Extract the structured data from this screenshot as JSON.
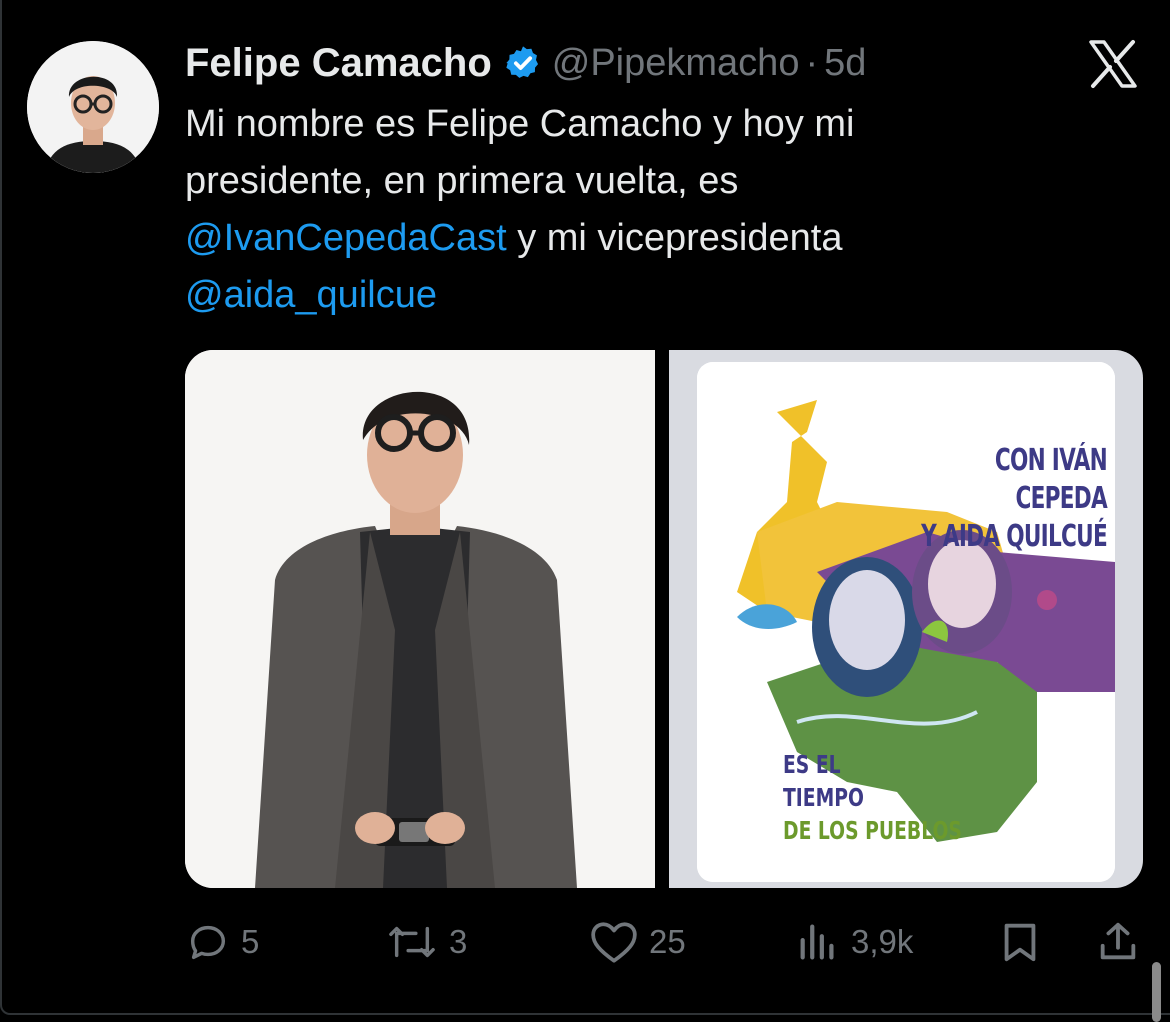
{
  "user": {
    "name": "Felipe Camacho",
    "handle": "@Pipekmacho",
    "separator": "·",
    "time": "5d",
    "verified": true
  },
  "tweet": {
    "line1": "Mi nombre es Felipe Camacho y hoy mi",
    "line2": "presidente, en primera vuelta, es",
    "mention1": "@IvanCepedaCast",
    "line3_rest": " y mi vicepresidenta",
    "mention2": "@aida_quilcue"
  },
  "poster": {
    "title_line1": "CON IVÁN CEPEDA",
    "title_line2": "Y AIDA QUILCUÉ",
    "bottom_line1": "ES EL",
    "bottom_line2": "TIEMPO",
    "bottom_line3": "DE LOS PUEBLOS"
  },
  "actions": {
    "replies": "5",
    "reposts": "3",
    "likes": "25",
    "views": "3,9k"
  },
  "icons": [
    "verified-badge-icon",
    "x-logo-icon",
    "reply-icon",
    "repost-icon",
    "like-icon",
    "views-icon",
    "bookmark-icon",
    "share-icon"
  ],
  "colors": {
    "background": "#000000",
    "text": "#e7e9ea",
    "muted": "#71767b",
    "link": "#1d9bf0",
    "verified": "#1d9bf0",
    "poster_blue": "#3d3a86",
    "poster_green": "#6c9a2c"
  }
}
